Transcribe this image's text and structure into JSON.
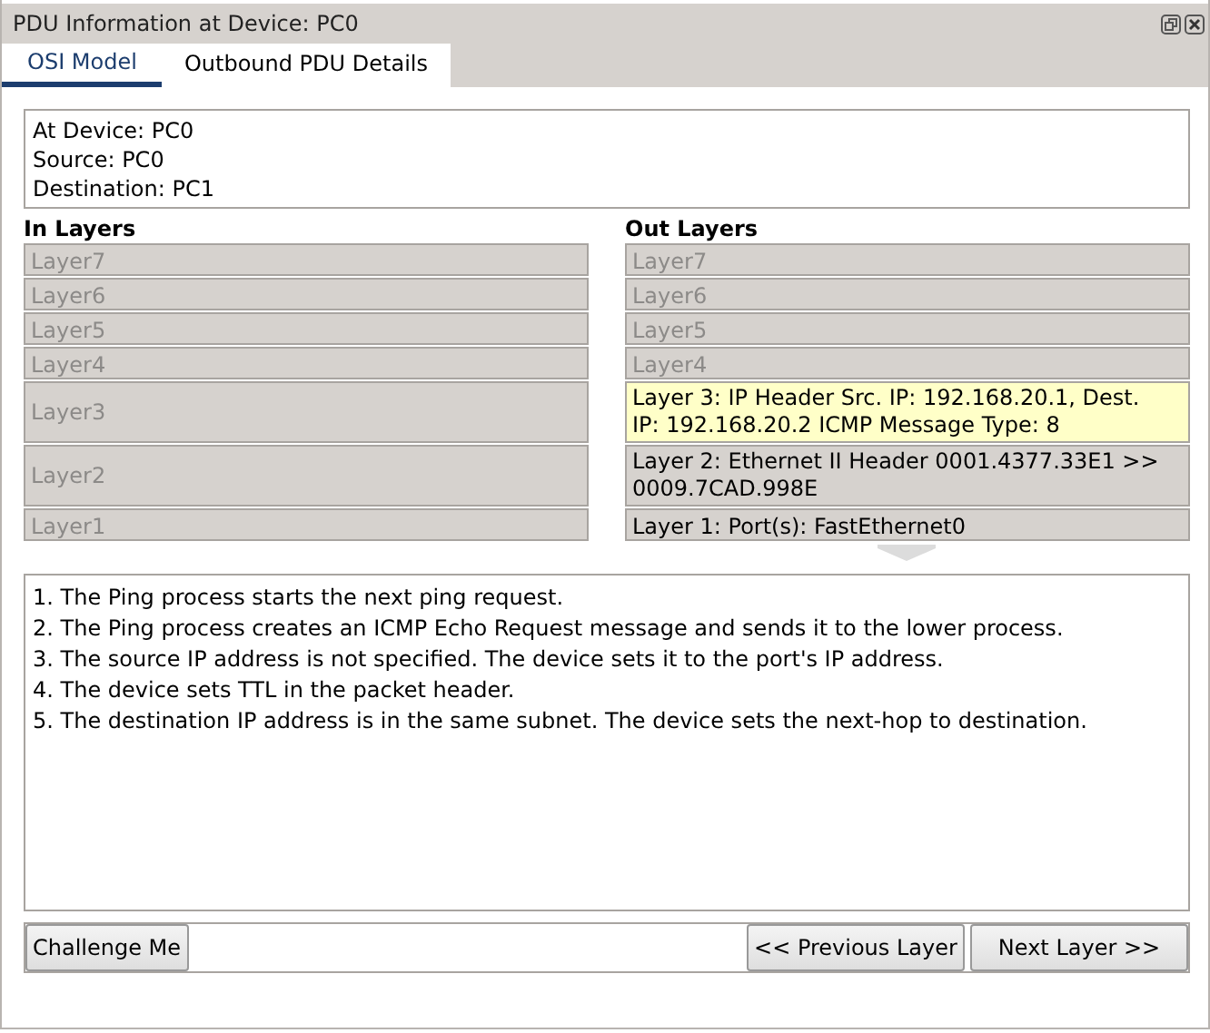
{
  "window": {
    "title": "PDU Information at Device: PC0"
  },
  "tabs": [
    {
      "label": "OSI Model",
      "selected": true
    },
    {
      "label": "Outbound PDU Details",
      "selected": false
    }
  ],
  "device_info": [
    "At Device: PC0",
    "Source: PC0",
    "Destination: PC1"
  ],
  "in_layers": {
    "heading": "In Layers",
    "layers": [
      {
        "label": "Layer7",
        "disabled": true,
        "selected": false,
        "kind": "single"
      },
      {
        "label": "Layer6",
        "disabled": true,
        "selected": false,
        "kind": "single"
      },
      {
        "label": "Layer5",
        "disabled": true,
        "selected": false,
        "kind": "single"
      },
      {
        "label": "Layer4",
        "disabled": true,
        "selected": false,
        "kind": "single"
      },
      {
        "label": "Layer3",
        "disabled": true,
        "selected": false,
        "kind": "double"
      },
      {
        "label": "Layer2",
        "disabled": true,
        "selected": false,
        "kind": "double"
      },
      {
        "label": "Layer1",
        "disabled": true,
        "selected": false,
        "kind": "single"
      }
    ]
  },
  "out_layers": {
    "heading": "Out Layers",
    "layers": [
      {
        "label": "Layer7",
        "disabled": true,
        "selected": false,
        "kind": "single"
      },
      {
        "label": "Layer6",
        "disabled": true,
        "selected": false,
        "kind": "single"
      },
      {
        "label": "Layer5",
        "disabled": true,
        "selected": false,
        "kind": "single"
      },
      {
        "label": "Layer4",
        "disabled": true,
        "selected": false,
        "kind": "single"
      },
      {
        "label": "Layer 3: IP Header Src. IP: 192.168.20.1, Dest. IP: 192.168.20.2 ICMP Message Type: 8",
        "disabled": false,
        "selected": true,
        "kind": "double"
      },
      {
        "label": "Layer 2: Ethernet II Header 0001.4377.33E1 >> 0009.7CAD.998E",
        "disabled": false,
        "selected": false,
        "kind": "double"
      },
      {
        "label": "Layer 1: Port(s): FastEthernet0",
        "disabled": false,
        "selected": false,
        "kind": "single"
      }
    ]
  },
  "description": [
    "1. The Ping process starts the next ping request.",
    "2. The Ping process creates an ICMP Echo Request message and sends it to the lower process.",
    "3. The source IP address is not specified. The device sets it to the port's IP address.",
    "4. The device sets TTL in the packet header.",
    "5. The destination IP address is in the same subnet. The device sets the next-hop to destination."
  ],
  "buttons": {
    "challenge": "Challenge Me",
    "previous": "<< Previous Layer",
    "next": "Next Layer >>"
  }
}
